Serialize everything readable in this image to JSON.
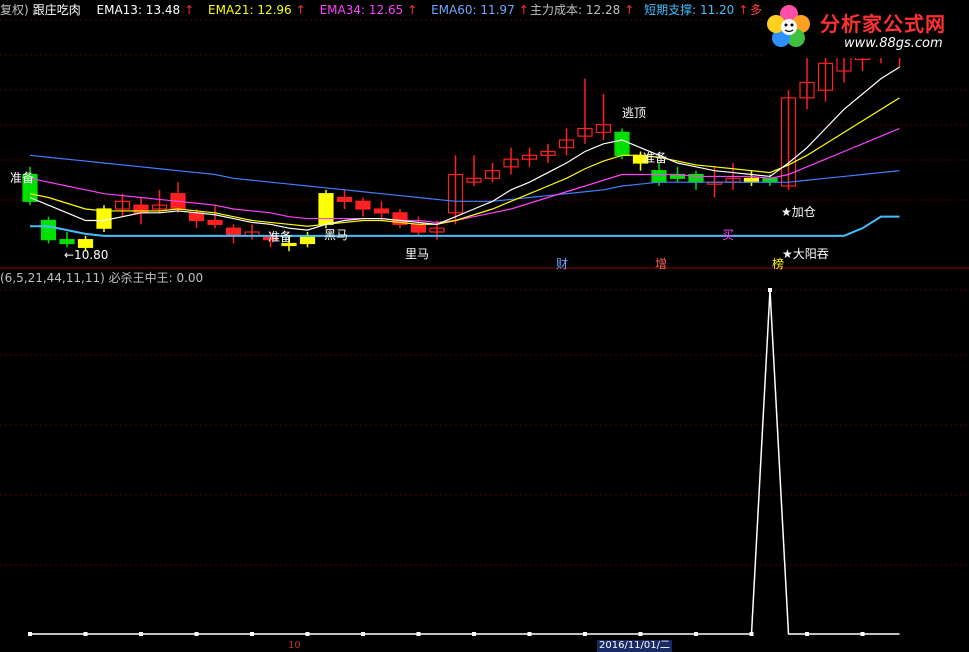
{
  "header": {
    "prefix": "复权)",
    "indicator_name": "跟庄吃肉",
    "ema13": "EMA13: 13.48",
    "ema21": "EMA21: 12.96",
    "ema34": "EMA34: 12.65",
    "ema60": "EMA60: 11.97",
    "cost_label": "主力成本: 12.28",
    "support_label": "短期支撑: 11.20",
    "duo": "多:",
    "arrow_glyph": "↑"
  },
  "logo": {
    "title": "分析家公式网",
    "url": "www.88gs.com"
  },
  "annotations": {
    "price_low": "←10.80",
    "zhunbei_left": "准备",
    "zhunbei_mid": "准备",
    "heima_1": "黑马",
    "heima_2": "里马",
    "taoding": "逃顶",
    "zhunbei_right": "准备",
    "jiacang": "★加仓",
    "mai": "买",
    "cai": "财",
    "zeng": "增",
    "bang": "榜",
    "dayangtun": "★大阳吞"
  },
  "indicator": {
    "header": "(6,5,21,44,11,11)  必杀王中王: 0.00"
  },
  "footer": {
    "date": "2016/11/01/二",
    "tick": "10"
  },
  "colors": {
    "background": "#000000",
    "grid": "#5a0000",
    "up_candle": "#ff2020",
    "down_candle": "#00e000",
    "yellow_candle": "#ffff00",
    "ema13": "#ffffff",
    "ema21": "#ffff00",
    "ema34": "#ff40ff",
    "ema60": "#4080ff",
    "support": "#40c0ff",
    "indicator_line": "#ffffff"
  },
  "candles": [
    {
      "o": 12.3,
      "c": 11.6,
      "h": 12.5,
      "l": 11.5,
      "style": "down"
    },
    {
      "o": 11.1,
      "c": 10.6,
      "h": 11.2,
      "l": 10.5,
      "style": "down"
    },
    {
      "o": 10.6,
      "c": 10.5,
      "h": 10.8,
      "l": 10.4,
      "style": "down"
    },
    {
      "o": 10.4,
      "c": 10.6,
      "h": 10.7,
      "l": 10.3,
      "style": "yellow"
    },
    {
      "o": 10.9,
      "c": 11.4,
      "h": 11.5,
      "l": 10.8,
      "style": "yellow"
    },
    {
      "o": 11.4,
      "c": 11.6,
      "h": 11.8,
      "l": 11.2,
      "style": "up"
    },
    {
      "o": 11.5,
      "c": 11.3,
      "h": 11.7,
      "l": 11.0,
      "style": "up"
    },
    {
      "o": 11.4,
      "c": 11.5,
      "h": 11.9,
      "l": 11.3,
      "style": "up"
    },
    {
      "o": 11.8,
      "c": 11.4,
      "h": 12.1,
      "l": 11.3,
      "style": "up"
    },
    {
      "o": 11.3,
      "c": 11.1,
      "h": 11.4,
      "l": 10.9,
      "style": "up"
    },
    {
      "o": 11.1,
      "c": 11.0,
      "h": 11.5,
      "l": 10.9,
      "style": "up"
    },
    {
      "o": 10.9,
      "c": 10.7,
      "h": 11.0,
      "l": 10.5,
      "style": "up"
    },
    {
      "o": 10.7,
      "c": 10.8,
      "h": 11.0,
      "l": 10.6,
      "style": "up"
    },
    {
      "o": 10.7,
      "c": 10.6,
      "h": 10.8,
      "l": 10.4,
      "style": "up"
    },
    {
      "o": 10.5,
      "c": 10.5,
      "h": 10.7,
      "l": 10.3,
      "style": "yellow"
    },
    {
      "o": 10.5,
      "c": 10.7,
      "h": 10.8,
      "l": 10.4,
      "style": "yellow"
    },
    {
      "o": 11.0,
      "c": 11.8,
      "h": 11.9,
      "l": 10.9,
      "style": "yellow"
    },
    {
      "o": 11.7,
      "c": 11.6,
      "h": 11.9,
      "l": 11.4,
      "style": "up"
    },
    {
      "o": 11.6,
      "c": 11.4,
      "h": 11.7,
      "l": 11.2,
      "style": "up"
    },
    {
      "o": 11.4,
      "c": 11.3,
      "h": 11.6,
      "l": 11.1,
      "style": "up"
    },
    {
      "o": 11.3,
      "c": 11.0,
      "h": 11.4,
      "l": 10.9,
      "style": "up"
    },
    {
      "o": 11.0,
      "c": 10.8,
      "h": 11.2,
      "l": 10.7,
      "style": "up"
    },
    {
      "o": 10.8,
      "c": 10.9,
      "h": 11.1,
      "l": 10.6,
      "style": "up"
    },
    {
      "o": 11.3,
      "c": 12.3,
      "h": 12.8,
      "l": 11.0,
      "style": "up"
    },
    {
      "o": 12.1,
      "c": 12.2,
      "h": 12.8,
      "l": 12.0,
      "style": "up"
    },
    {
      "o": 12.2,
      "c": 12.4,
      "h": 12.6,
      "l": 12.1,
      "style": "up"
    },
    {
      "o": 12.5,
      "c": 12.7,
      "h": 13.0,
      "l": 12.3,
      "style": "up"
    },
    {
      "o": 12.7,
      "c": 12.8,
      "h": 13.0,
      "l": 12.5,
      "style": "up"
    },
    {
      "o": 12.8,
      "c": 12.9,
      "h": 13.1,
      "l": 12.6,
      "style": "up"
    },
    {
      "o": 13.0,
      "c": 13.2,
      "h": 13.5,
      "l": 12.8,
      "style": "up"
    },
    {
      "o": 13.3,
      "c": 13.5,
      "h": 14.8,
      "l": 13.1,
      "style": "up"
    },
    {
      "o": 13.4,
      "c": 13.6,
      "h": 14.4,
      "l": 13.2,
      "style": "up"
    },
    {
      "o": 13.4,
      "c": 12.8,
      "h": 13.5,
      "l": 12.7,
      "style": "down"
    },
    {
      "o": 12.8,
      "c": 12.6,
      "h": 12.9,
      "l": 12.4,
      "style": "yellow"
    },
    {
      "o": 12.4,
      "c": 12.1,
      "h": 12.6,
      "l": 12.0,
      "style": "down"
    },
    {
      "o": 12.3,
      "c": 12.2,
      "h": 12.5,
      "l": 12.1,
      "style": "down"
    },
    {
      "o": 12.3,
      "c": 12.1,
      "h": 12.4,
      "l": 11.9,
      "style": "down"
    },
    {
      "o": 12.1,
      "c": 12.1,
      "h": 12.5,
      "l": 11.7,
      "style": "up"
    },
    {
      "o": 12.1,
      "c": 12.2,
      "h": 12.6,
      "l": 11.9,
      "style": "up"
    },
    {
      "o": 12.2,
      "c": 12.1,
      "h": 12.4,
      "l": 12.0,
      "style": "yellow"
    },
    {
      "o": 12.2,
      "c": 12.1,
      "h": 12.3,
      "l": 12.0,
      "style": "down"
    },
    {
      "o": 12.0,
      "c": 14.3,
      "h": 14.5,
      "l": 11.9,
      "style": "up"
    },
    {
      "o": 14.3,
      "c": 14.7,
      "h": 15.5,
      "l": 14.0,
      "style": "up"
    },
    {
      "o": 14.5,
      "c": 15.2,
      "h": 16.0,
      "l": 14.2,
      "style": "up"
    },
    {
      "o": 15.0,
      "c": 15.4,
      "h": 15.6,
      "l": 14.7,
      "style": "up"
    },
    {
      "o": 15.3,
      "c": 15.7,
      "h": 15.8,
      "l": 15.0,
      "style": "up"
    },
    {
      "o": 15.5,
      "c": 15.6,
      "h": 15.9,
      "l": 15.2,
      "style": "up"
    },
    {
      "o": 15.5,
      "c": 15.4,
      "h": 15.7,
      "l": 15.1,
      "style": "up"
    }
  ],
  "ema13_vals": [
    11.7,
    11.5,
    11.3,
    11.1,
    11.1,
    11.2,
    11.3,
    11.3,
    11.35,
    11.3,
    11.25,
    11.15,
    11.05,
    11.0,
    10.9,
    10.85,
    11.0,
    11.1,
    11.15,
    11.15,
    11.1,
    11.05,
    11.0,
    11.2,
    11.4,
    11.6,
    11.9,
    12.1,
    12.35,
    12.6,
    12.9,
    13.1,
    13.2,
    13.0,
    12.8,
    12.6,
    12.5,
    12.4,
    12.35,
    12.3,
    12.25,
    12.6,
    13.0,
    13.5,
    14.0,
    14.4,
    14.8,
    15.1
  ],
  "ema21_vals": [
    11.8,
    11.7,
    11.55,
    11.4,
    11.35,
    11.35,
    11.35,
    11.35,
    11.4,
    11.35,
    11.3,
    11.2,
    11.1,
    11.05,
    11.0,
    10.95,
    11.0,
    11.05,
    11.1,
    11.1,
    11.05,
    11.0,
    11.0,
    11.1,
    11.25,
    11.4,
    11.6,
    11.8,
    12.0,
    12.2,
    12.45,
    12.65,
    12.8,
    12.8,
    12.75,
    12.65,
    12.55,
    12.5,
    12.45,
    12.4,
    12.35,
    12.55,
    12.8,
    13.1,
    13.4,
    13.7,
    14.0,
    14.3
  ],
  "ema34_vals": [
    12.2,
    12.1,
    12.0,
    11.9,
    11.8,
    11.75,
    11.7,
    11.65,
    11.6,
    11.55,
    11.5,
    11.4,
    11.35,
    11.3,
    11.2,
    11.15,
    11.15,
    11.15,
    11.15,
    11.15,
    11.1,
    11.1,
    11.05,
    11.1,
    11.2,
    11.3,
    11.4,
    11.55,
    11.7,
    11.85,
    12.0,
    12.15,
    12.3,
    12.3,
    12.3,
    12.3,
    12.25,
    12.25,
    12.25,
    12.25,
    12.2,
    12.3,
    12.5,
    12.7,
    12.9,
    13.1,
    13.3,
    13.5
  ],
  "ema60_vals": [
    12.8,
    12.75,
    12.7,
    12.65,
    12.6,
    12.55,
    12.5,
    12.45,
    12.4,
    12.35,
    12.3,
    12.2,
    12.15,
    12.1,
    12.05,
    12.0,
    11.95,
    11.9,
    11.85,
    11.8,
    11.75,
    11.7,
    11.65,
    11.6,
    11.6,
    11.6,
    11.65,
    11.7,
    11.75,
    11.8,
    11.85,
    11.9,
    12.0,
    12.05,
    12.1,
    12.1,
    12.1,
    12.1,
    12.1,
    12.1,
    12.1,
    12.1,
    12.15,
    12.2,
    12.25,
    12.3,
    12.35,
    12.4
  ],
  "support_vals": [
    10.95,
    10.95,
    10.85,
    10.75,
    10.7,
    10.7,
    10.7,
    10.7,
    10.7,
    10.7,
    10.7,
    10.7,
    10.7,
    10.7,
    10.7,
    10.7,
    10.7,
    10.7,
    10.7,
    10.7,
    10.7,
    10.7,
    10.7,
    10.7,
    10.7,
    10.7,
    10.7,
    10.7,
    10.7,
    10.7,
    10.7,
    10.7,
    10.7,
    10.7,
    10.7,
    10.7,
    10.7,
    10.7,
    10.7,
    10.7,
    10.7,
    10.7,
    10.7,
    10.7,
    10.7,
    10.9,
    11.2,
    11.2
  ],
  "indicator_values": [
    0,
    0,
    0,
    0,
    0,
    0,
    0,
    0,
    0,
    0,
    0,
    0,
    0,
    0,
    0,
    0,
    0,
    0,
    0,
    0,
    0,
    0,
    0,
    0,
    0,
    0,
    0,
    0,
    0,
    0,
    0,
    0,
    0,
    0,
    0,
    0,
    0,
    0,
    0,
    0,
    1,
    0,
    0,
    0,
    0,
    0,
    0,
    0
  ],
  "indicator_max": 1
}
